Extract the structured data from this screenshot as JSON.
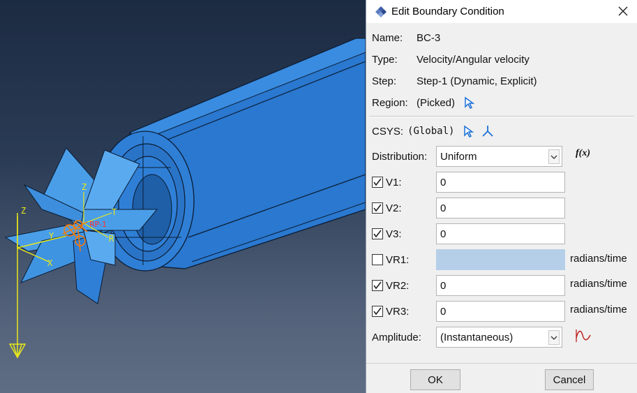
{
  "dialog": {
    "title": "Edit Boundary Condition",
    "name_label": "Name:",
    "name_value": "BC-3",
    "type_label": "Type:",
    "type_value": "Velocity/Angular velocity",
    "step_label": "Step:",
    "step_value": "Step-1 (Dynamic, Explicit)",
    "region_label": "Region:",
    "region_value": "(Picked)",
    "csys_label": "CSYS:",
    "csys_value": "(Global)",
    "distribution_label": "Distribution:",
    "distribution_value": "Uniform",
    "fx_label": "f(x)",
    "fields": [
      {
        "label": "V1:",
        "value": "0",
        "checked": true,
        "unit": ""
      },
      {
        "label": "V2:",
        "value": "0",
        "checked": true,
        "unit": ""
      },
      {
        "label": "V3:",
        "value": "0",
        "checked": true,
        "unit": ""
      },
      {
        "label": "VR1:",
        "value": "",
        "checked": false,
        "unit": "radians/time"
      },
      {
        "label": "VR2:",
        "value": "0",
        "checked": true,
        "unit": "radians/time"
      },
      {
        "label": "VR3:",
        "value": "0",
        "checked": true,
        "unit": "radians/time"
      }
    ],
    "amplitude_label": "Amplitude:",
    "amplitude_value": "(Instantaneous)",
    "ok_label": "OK",
    "cancel_label": "Cancel"
  },
  "viewport": {
    "triad_labels": {
      "z1": "Z",
      "y": "Y",
      "x": "X",
      "z2": "Z",
      "t": "T",
      "r": "R",
      "rp": "RP-1"
    }
  },
  "colors": {
    "part_blue": "#2f7fd6",
    "plane_blue": "#4a9ee8",
    "triad_yellow": "#e8e81a",
    "bc_orange": "#ff7a00",
    "picker_blue": "#1a6fd8"
  }
}
